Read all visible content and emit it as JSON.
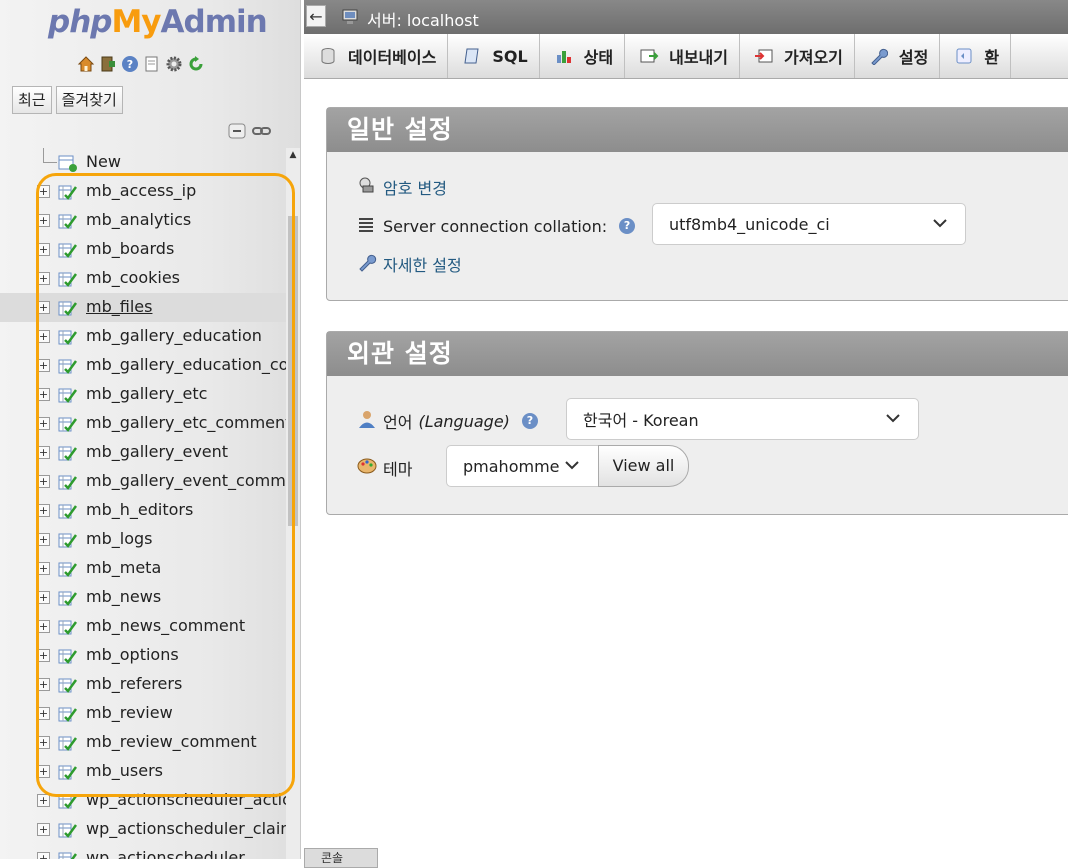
{
  "logo": {
    "php": "php",
    "my": "My",
    "admin": "Admin"
  },
  "nav": {
    "toolbar_icons": [
      "home-icon",
      "logout-icon",
      "help-icon",
      "docs-icon",
      "settings-icon",
      "reload-icon"
    ],
    "buttons": {
      "recent": "최근",
      "favorites": "즐겨찾기"
    },
    "new_label": "New",
    "tables": [
      "mb_access_ip",
      "mb_analytics",
      "mb_boards",
      "mb_cookies",
      "mb_files",
      "mb_gallery_education",
      "mb_gallery_education_com",
      "mb_gallery_etc",
      "mb_gallery_etc_comment",
      "mb_gallery_event",
      "mb_gallery_event_commer",
      "mb_h_editors",
      "mb_logs",
      "mb_meta",
      "mb_news",
      "mb_news_comment",
      "mb_options",
      "mb_referers",
      "mb_review",
      "mb_review_comment",
      "mb_users",
      "wp_actionscheduler_action",
      "wp_actionscheduler_claims",
      "wp_actionscheduler_"
    ],
    "active_table": "mb_files"
  },
  "topbar": {
    "back": "←",
    "server_label": "서버: localhost"
  },
  "tabs": [
    {
      "label": "데이터베이스",
      "icon": "database-icon"
    },
    {
      "label": "SQL",
      "icon": "sql-icon"
    },
    {
      "label": "상태",
      "icon": "status-icon"
    },
    {
      "label": "내보내기",
      "icon": "export-icon"
    },
    {
      "label": "가져오기",
      "icon": "import-icon"
    },
    {
      "label": "설정",
      "icon": "wrench-icon"
    },
    {
      "label": "환",
      "icon": "replication-icon"
    }
  ],
  "general": {
    "title": "일반 설정",
    "change_password": "암호 변경",
    "collation_label": "Server connection collation:",
    "collation_value": "utf8mb4_unicode_ci",
    "more_settings": "자세한 설정"
  },
  "appearance": {
    "title": "외관 설정",
    "language_label": "언어",
    "language_label_en": "(Language)",
    "language_value": "한국어 - Korean",
    "theme_label": "테마",
    "theme_value": "pmahomme",
    "view_all": "View all"
  },
  "console": {
    "label": "콘솔"
  },
  "colors": {
    "highlight": "#f6a50b",
    "link": "#235a81",
    "panel_head": "#999999"
  }
}
